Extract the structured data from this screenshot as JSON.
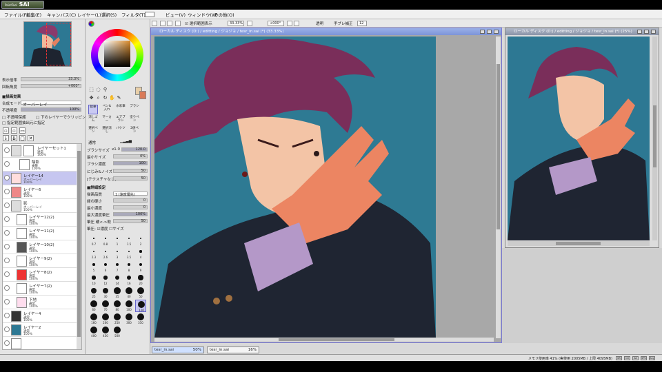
{
  "app": {
    "logo_text": "SAI",
    "logo_small": "PaintTool"
  },
  "menu": [
    "ファイル(F)",
    "編集(E)",
    "キャンバス(C)",
    "レイヤー(L)",
    "選択(S)",
    "フィルタ(T)",
    "ビュー(V)",
    "ウィンドウ(W)",
    "その他(O)"
  ],
  "toolbar": {
    "zoom": "33.33%",
    "angle": "+000°",
    "stabilizer_label": "手ブレ補正",
    "stabilizer_value": "12",
    "selection_checkbox": "選択範囲表示",
    "opacity_label": "透明"
  },
  "navigator": {
    "zoom_label": "表示倍率",
    "zoom_value": "33.3%",
    "angle_label": "回転角度",
    "angle_value": "+000°"
  },
  "layer_props": {
    "section": "■描画効果",
    "blend_label": "合成モード",
    "blend_value": "オーバーレイ",
    "opacity_label": "不透明度",
    "opacity_value": "100%",
    "protect": "不透明保護",
    "clip": "下のレイヤーでクリッピング",
    "select_src": "指定範囲抽出元に指定"
  },
  "layers": [
    {
      "name": "レイヤーセット1",
      "mode": "通常",
      "opacity": "100%"
    },
    {
      "name": "陰影",
      "mode": "乗算",
      "opacity": "100%"
    },
    {
      "name": "レイヤー14",
      "mode": "オーバーレイ",
      "opacity": "100%"
    },
    {
      "name": "レイヤー6",
      "mode": "通常",
      "opacity": "100%"
    },
    {
      "name": "影",
      "mode": "オーバーレイ",
      "opacity": "100%"
    },
    {
      "name": "レイヤー12(2)",
      "mode": "通常",
      "opacity": "100%"
    },
    {
      "name": "レイヤー11(2)",
      "mode": "通常",
      "opacity": "100%"
    },
    {
      "name": "レイヤー10(2)",
      "mode": "通常",
      "opacity": "100%"
    },
    {
      "name": "レイヤー9(2)",
      "mode": "通常",
      "opacity": "100%"
    },
    {
      "name": "レイヤー8(2)",
      "mode": "通常",
      "opacity": "100%"
    },
    {
      "name": "レイヤー7(2)",
      "mode": "通常",
      "opacity": "100%"
    },
    {
      "name": "下地",
      "mode": "通常",
      "opacity": "100%"
    },
    {
      "name": "レイヤー4",
      "mode": "通常",
      "opacity": "100%"
    },
    {
      "name": "レイヤー2",
      "mode": "通常",
      "opacity": "100%"
    }
  ],
  "tools": {
    "row1": [
      "鉛筆",
      "ペン&入れ",
      "水彩筆",
      "ブラシ"
    ],
    "row2": [
      "消しゴム",
      "マーカー",
      "エアブラシ",
      "塗りペン"
    ],
    "row3": [
      "選択ペン",
      "選択消し",
      "バケツ",
      "2値ペン"
    ],
    "brush_size_label": "ブラシサイズ",
    "brush_size_mult": "x1.0",
    "brush_size_value": "120.0",
    "min_size_label": "最小サイズ",
    "min_size_value": "0%",
    "density_label": "ブラシ濃度",
    "density_value": "100",
    "edge_label": "にじみ&ノイズ",
    "edge_value": "50",
    "texture_label": "[テクスチャなし]",
    "texture_value": "50",
    "detail_section": "■詳細設定",
    "quality_label": "描画品質",
    "quality_value": "1 (速度優先)",
    "edge_hard_label": "縁の硬さ",
    "edge_hard_value": "0",
    "min_dens_label": "最小濃度",
    "min_dens_value": "0",
    "max_dens_label": "最大濃度筆圧",
    "max_dens_value": "100%",
    "press_label": "筆圧 硬<->軟",
    "press_value": "50",
    "press_check": "筆圧:",
    "press_dens": "濃度",
    "press_size": "サイズ",
    "normal": "通常",
    "brush_sizes": [
      "0.7",
      "0.8",
      "1",
      "1.5",
      "2",
      "2.3",
      "2.6",
      "3",
      "3.5",
      "4",
      "5",
      "6",
      "7",
      "8",
      "9",
      "10",
      "12",
      "14",
      "16",
      "20",
      "25",
      "30",
      "35",
      "40",
      "50",
      "60",
      "70",
      "80",
      "100",
      "120",
      "160",
      "200",
      "250",
      "300",
      "350",
      "400",
      "450",
      "500"
    ]
  },
  "canvas": {
    "title": "ローカル ディスク (D:) / editting / ジョジョ / tesr_in.sai (*) (33.33%)"
  },
  "preview": {
    "title": "ローカル ディスク (D:) / editting / ジョジョ / tesr_in.sai (*) (25%)"
  },
  "tabs": [
    {
      "name": "tesr_in.sai",
      "zoom": "50%"
    },
    {
      "name": "tesr_in.sai",
      "zoom": "16%"
    }
  ],
  "status": {
    "memory": "メモリ使用率 41% (実使用 2005MB / 上限 4095MB)",
    "indicators": [
      "Sft",
      "Ctl",
      "Alt",
      "SPC",
      "Any"
    ]
  }
}
